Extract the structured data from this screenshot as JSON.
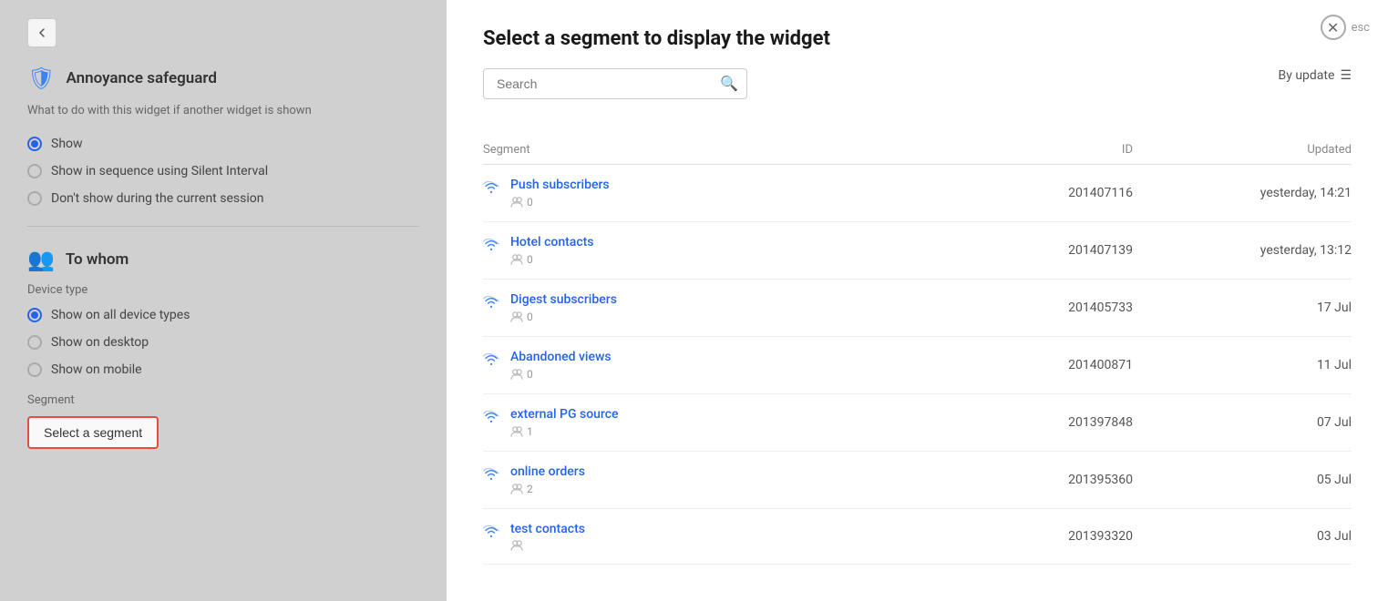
{
  "background": {
    "back_button_label": "←",
    "annoyance_section": {
      "title": "Annoyance safeguard",
      "description": "What to do with this widget if another widget is shown",
      "options": [
        {
          "id": "show",
          "label": "Show",
          "selected": true
        },
        {
          "id": "sequence",
          "label": "Show in sequence using Silent Interval",
          "selected": false
        },
        {
          "id": "dont_show",
          "label": "Don't show during the current session",
          "selected": false
        }
      ]
    },
    "to_whom_section": {
      "title": "To whom",
      "device_type_label": "Device type",
      "device_options": [
        {
          "id": "all",
          "label": "Show on all device types",
          "selected": true
        },
        {
          "id": "desktop",
          "label": "Show on desktop",
          "selected": false
        },
        {
          "id": "mobile",
          "label": "Show on mobile",
          "selected": false
        }
      ],
      "segment_label": "Segment",
      "select_segment_btn": "Select a segment"
    }
  },
  "modal": {
    "title": "Select a segment to display the widget",
    "close_label": "esc",
    "search_placeholder": "Search",
    "sort_label": "By update",
    "table_headers": {
      "segment": "Segment",
      "id": "ID",
      "updated": "Updated"
    },
    "segments": [
      {
        "name": "Push subscribers",
        "count": 0,
        "id": "201407116",
        "updated": "yesterday, 14:21"
      },
      {
        "name": "Hotel contacts",
        "count": 0,
        "id": "201407139",
        "updated": "yesterday, 13:12"
      },
      {
        "name": "Digest subscribers",
        "count": 0,
        "id": "201405733",
        "updated": "17 Jul"
      },
      {
        "name": "Abandoned views",
        "count": 0,
        "id": "201400871",
        "updated": "11 Jul"
      },
      {
        "name": "external PG source",
        "count": 1,
        "id": "201397848",
        "updated": "07 Jul"
      },
      {
        "name": "online orders",
        "count": 2,
        "id": "201395360",
        "updated": "05 Jul"
      },
      {
        "name": "test contacts",
        "count": null,
        "id": "201393320",
        "updated": "03 Jul"
      }
    ]
  }
}
